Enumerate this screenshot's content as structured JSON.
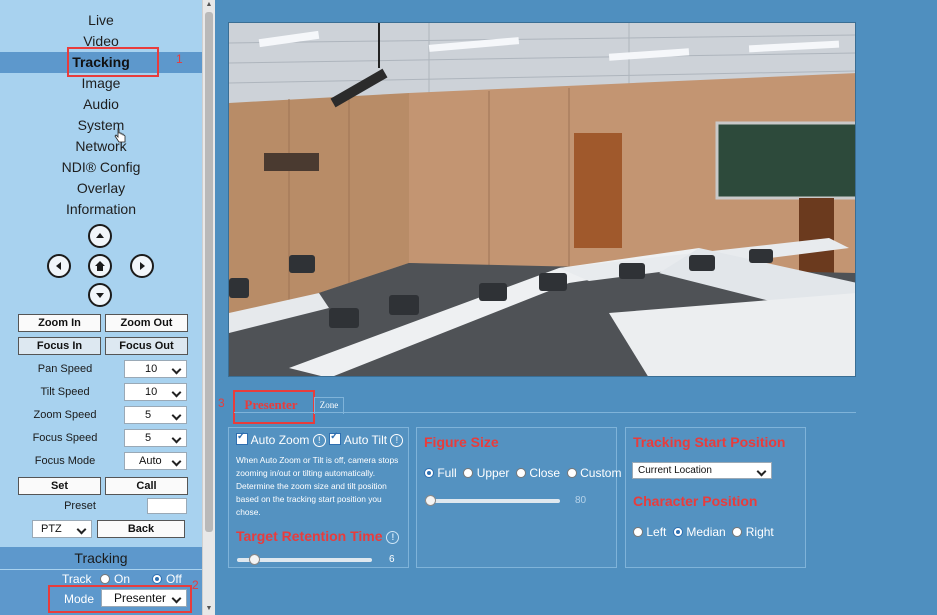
{
  "nav": {
    "items": [
      "Live",
      "Video",
      "Tracking",
      "Image",
      "Audio",
      "System",
      "Network",
      "NDI® Config",
      "Overlay",
      "Information"
    ],
    "active": "Tracking"
  },
  "annotations": {
    "tag1": "1",
    "tag2": "2",
    "tag3": "3"
  },
  "ptz": {
    "zoom_in": "Zoom In",
    "zoom_out": "Zoom Out",
    "focus_in": "Focus In",
    "focus_out": "Focus Out",
    "pan_speed_label": "Pan Speed",
    "pan_speed": "10",
    "tilt_speed_label": "Tilt Speed",
    "tilt_speed": "10",
    "zoom_speed_label": "Zoom Speed",
    "zoom_speed": "5",
    "focus_speed_label": "Focus Speed",
    "focus_speed": "5",
    "focus_mode_label": "Focus Mode",
    "focus_mode": "Auto",
    "set": "Set",
    "call": "Call",
    "preset_label": "Preset",
    "preset_value": "",
    "mode_select": "PTZ",
    "back": "Back"
  },
  "tracking_side": {
    "header": "Tracking",
    "track_label": "Track",
    "on": "On",
    "off": "Off",
    "track_state": "Off",
    "mode_label": "Mode",
    "mode_value": "Presenter"
  },
  "tabs": {
    "presenter": "Presenter",
    "zone": "Zone"
  },
  "panel_left": {
    "auto_zoom": "Auto Zoom",
    "auto_tilt": "Auto Tilt",
    "description": [
      "When Auto Zoom or Tilt is off, camera stops",
      "zooming in/out or tilting automatically.",
      "Determine the zoom size and tilt position",
      "based on the tracking start position you",
      "chose."
    ],
    "retention_title": "Target Retention Time",
    "retention_value": "6",
    "retention_fraction": 0.1
  },
  "panel_mid": {
    "title": "Figure Size",
    "options": [
      "Full",
      "Upper",
      "Close",
      "Custom"
    ],
    "selected": "Full",
    "slider_value": "80",
    "slider_fraction": 0.0
  },
  "panel_right": {
    "title": "Tracking Start Position",
    "start_value": "Current Location",
    "char_title": "Character Position",
    "options": [
      "Left",
      "Median",
      "Right"
    ],
    "selected": "Median"
  },
  "colors": {
    "accent_red": "#e83c3c",
    "sidebar_bg": "#a8d2ef",
    "main_bg": "#4f8fbf",
    "active_nav": "#5d98cc"
  }
}
